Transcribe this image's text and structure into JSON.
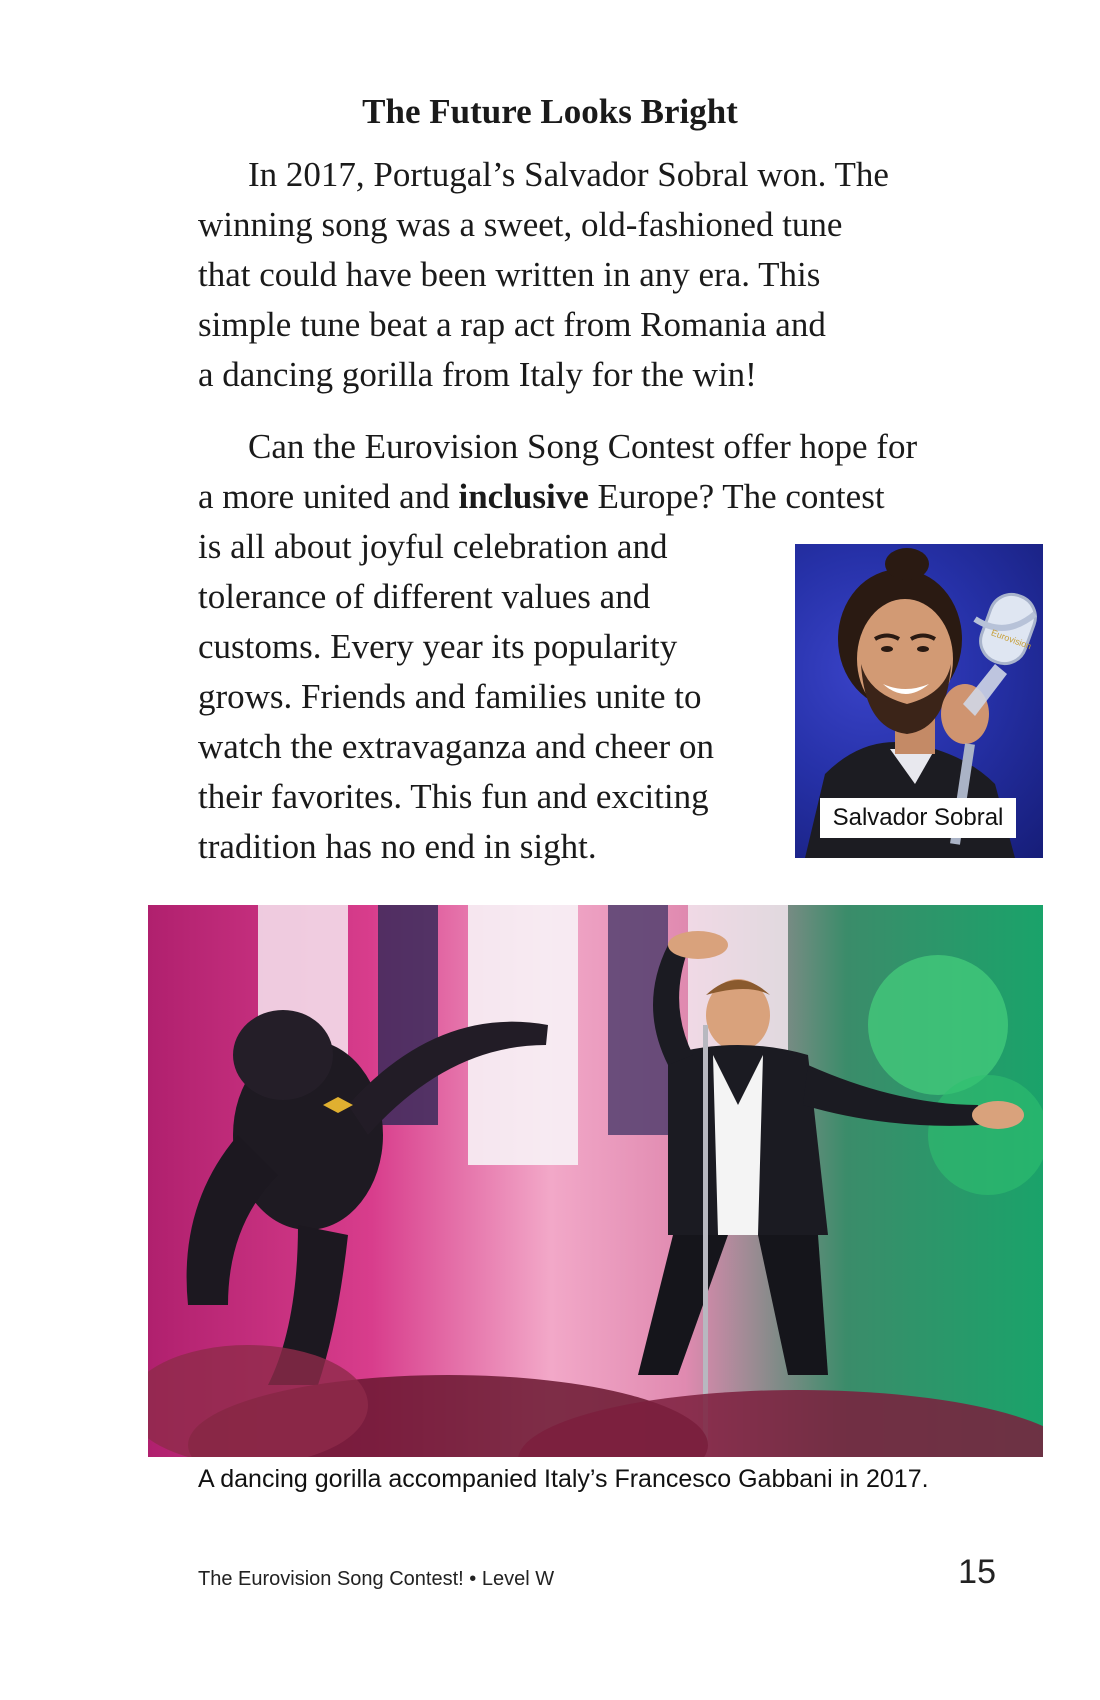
{
  "section": {
    "heading": "The Future Looks Bright"
  },
  "paragraph1": {
    "lines": [
      "In 2017, Portugal’s Salvador Sobral won. The",
      "winning song was a sweet, old-fashioned tune",
      "that could have been written in any era. This",
      "simple tune beat a rap act from Romania and",
      "a dancing gorilla from Italy for the win!"
    ]
  },
  "paragraph2": {
    "line1": "Can the Eurovision Song Contest offer hope for",
    "line2_before": "a more united and ",
    "line2_bold": "inclusive",
    "line2_after": " Europe? The contest",
    "lines_rest": [
      "is all about joyful celebration and",
      "tolerance of different values and",
      "customs. Every year its popularity",
      "grows. Friends and families unite to",
      "watch the extravaganza and cheer on",
      "their favorites. This fun and exciting",
      "tradition has no end in sight."
    ]
  },
  "photo_small": {
    "caption": "Salvador Sobral",
    "trophy_text": "Eurovision"
  },
  "photo_large": {
    "caption": "A dancing gorilla accompanied Italy’s Francesco Gabbani in 2017."
  },
  "footer": {
    "book_title": "The Eurovision Song Contest! • Level W",
    "page_number": "15"
  }
}
